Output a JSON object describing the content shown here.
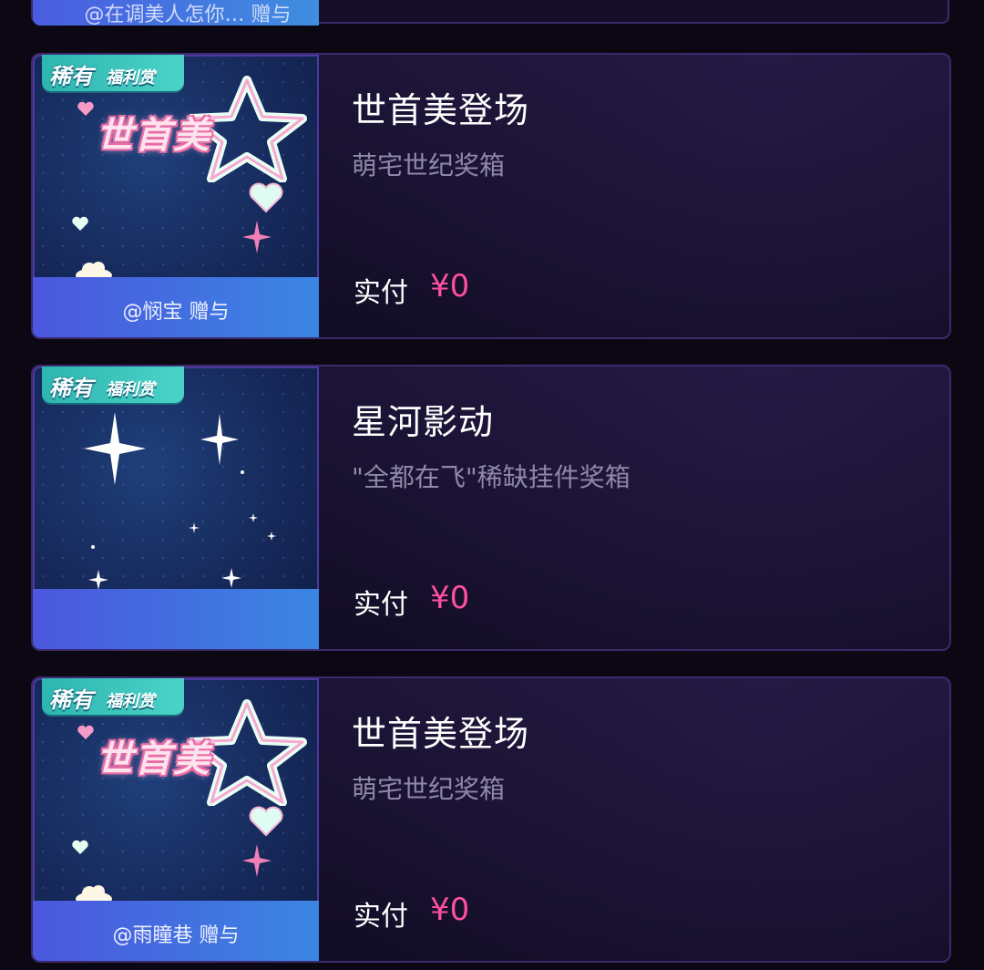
{
  "top_partial": {
    "gift_text": "@在调美人怎你… 赠与"
  },
  "cards": [
    {
      "badge_main": "稀有",
      "badge_sub": "福利赏",
      "art_title": "世首美",
      "gift_text": "@悯宝 赠与",
      "title": "世首美登场",
      "subtitle": "萌宅世纪奖箱",
      "pay_label": "实付",
      "price": "¥0"
    },
    {
      "badge_main": "稀有",
      "badge_sub": "福利赏",
      "gift_text": "",
      "title": "星河影动",
      "subtitle": "\"全都在飞\"稀缺挂件奖箱",
      "pay_label": "实付",
      "price": "¥0"
    },
    {
      "badge_main": "稀有",
      "badge_sub": "福利赏",
      "art_title": "世首美",
      "gift_text": "@雨瞳巷 赠与",
      "title": "世首美登场",
      "subtitle": "萌宅世纪奖箱",
      "pay_label": "实付",
      "price": "¥0"
    }
  ],
  "colors": {
    "background": "#0b0814",
    "price": "#ff4fa0",
    "gift_bar": "#4b57de",
    "badge": "#2db6b0"
  }
}
